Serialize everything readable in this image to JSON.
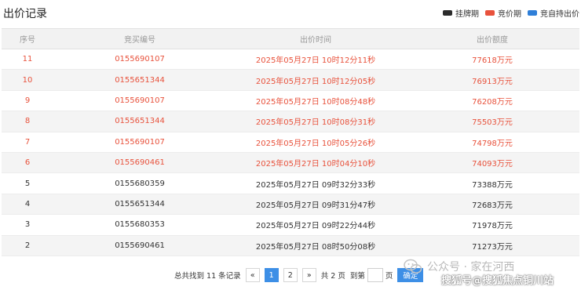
{
  "header": {
    "title": "出价记录",
    "legend": [
      {
        "label": "挂牌期",
        "color": "#2b2b2b"
      },
      {
        "label": "竞价期",
        "color": "#e8523c"
      },
      {
        "label": "竞自持出价",
        "color": "#2f7fd8"
      }
    ]
  },
  "table": {
    "columns": [
      "序号",
      "竞买编号",
      "出价时间",
      "出价额度"
    ],
    "rows": [
      {
        "seq": "11",
        "code": "0155690107",
        "time": "2025年05月27日 10时12分11秒",
        "amount": "77618万元",
        "status": "active"
      },
      {
        "seq": "10",
        "code": "0155651344",
        "time": "2025年05月27日 10时12分05秒",
        "amount": "76913万元",
        "status": "active"
      },
      {
        "seq": "9",
        "code": "0155690107",
        "time": "2025年05月27日 10时08分48秒",
        "amount": "76208万元",
        "status": "active"
      },
      {
        "seq": "8",
        "code": "0155651344",
        "time": "2025年05月27日 10时08分31秒",
        "amount": "75503万元",
        "status": "active"
      },
      {
        "seq": "7",
        "code": "0155690107",
        "time": "2025年05月27日 10时05分26秒",
        "amount": "74798万元",
        "status": "active"
      },
      {
        "seq": "6",
        "code": "0155690461",
        "time": "2025年05月27日 10时04分10秒",
        "amount": "74093万元",
        "status": "active"
      },
      {
        "seq": "5",
        "code": "0155680359",
        "time": "2025年05月27日 09时32分33秒",
        "amount": "73388万元",
        "status": "normal"
      },
      {
        "seq": "4",
        "code": "0155651344",
        "time": "2025年05月27日 09时31分47秒",
        "amount": "72683万元",
        "status": "normal"
      },
      {
        "seq": "3",
        "code": "0155680353",
        "time": "2025年05月27日 09时22分44秒",
        "amount": "71978万元",
        "status": "normal"
      },
      {
        "seq": "2",
        "code": "0155690461",
        "time": "2025年05月27日 08时50分08秒",
        "amount": "71273万元",
        "status": "normal"
      }
    ]
  },
  "pagination": {
    "total_text": "总共找到 11 条记录",
    "prev": "«",
    "pages": [
      "1",
      "2"
    ],
    "current_page": "1",
    "next": "»",
    "total_pages_text": "共 2 页",
    "jump_label": "到第",
    "page_suffix": "页",
    "confirm_label": "确定"
  },
  "watermarks": {
    "channel": "公众号 · 家在河西",
    "source": "搜狐号@搜狐焦点铜川站"
  }
}
